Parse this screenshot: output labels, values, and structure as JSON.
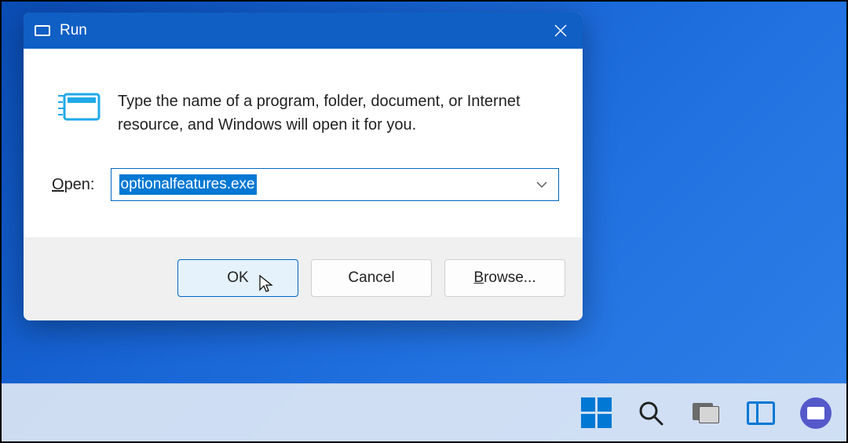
{
  "dialog": {
    "title": "Run",
    "description": "Type the name of a program, folder, document, or Internet resource, and Windows will open it for you.",
    "open_label_prefix": "O",
    "open_label_rest": "pen:",
    "input_value": "optionalfeatures.exe",
    "buttons": {
      "ok": "OK",
      "cancel": "Cancel",
      "browse_prefix": "B",
      "browse_rest": "rowse..."
    }
  },
  "taskbar": {
    "items": [
      "start",
      "search",
      "task-view",
      "widgets",
      "chat"
    ]
  }
}
